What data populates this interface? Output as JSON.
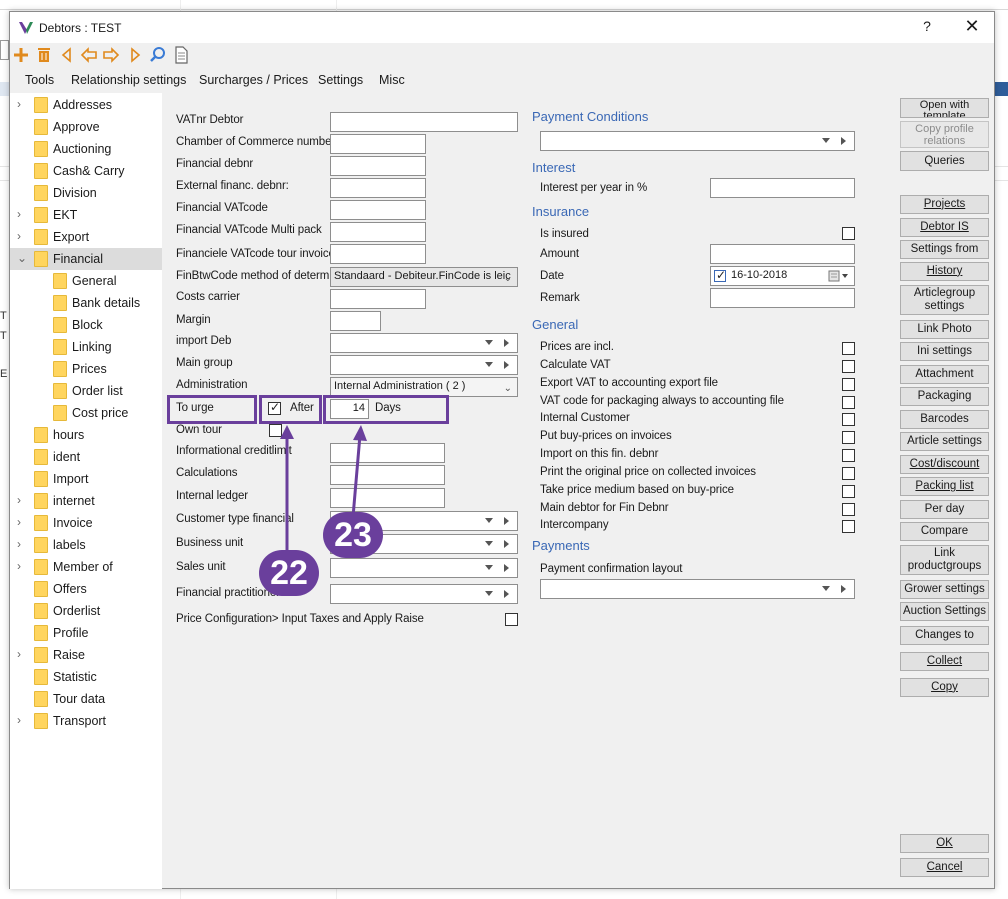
{
  "dialog": {
    "title": "Debtors : TEST",
    "help_label": "?",
    "close_label": "✕"
  },
  "menu": [
    "Tools",
    "Relationship settings",
    "Surcharges / Prices",
    "Settings",
    "Misc"
  ],
  "tree": [
    {
      "label": "Addresses",
      "expand": "›"
    },
    {
      "label": "Approve",
      "expand": ""
    },
    {
      "label": "Auctioning",
      "expand": ""
    },
    {
      "label": "Cash& Carry",
      "expand": ""
    },
    {
      "label": "Division",
      "expand": ""
    },
    {
      "label": "EKT",
      "expand": "›"
    },
    {
      "label": "Export",
      "expand": "›"
    },
    {
      "label": "Financial",
      "expand": "⌄"
    },
    {
      "label": "General",
      "expand": ""
    },
    {
      "label": "Bank details",
      "expand": ""
    },
    {
      "label": "Block",
      "expand": ""
    },
    {
      "label": "Linking",
      "expand": ""
    },
    {
      "label": "Prices",
      "expand": ""
    },
    {
      "label": "Order list",
      "expand": ""
    },
    {
      "label": "Cost price",
      "expand": ""
    },
    {
      "label": "hours",
      "expand": ""
    },
    {
      "label": "ident",
      "expand": ""
    },
    {
      "label": "Import",
      "expand": ""
    },
    {
      "label": "internet",
      "expand": "›"
    },
    {
      "label": "Invoice",
      "expand": "›"
    },
    {
      "label": "labels",
      "expand": "›"
    },
    {
      "label": "Member of",
      "expand": "›"
    },
    {
      "label": "Offers",
      "expand": ""
    },
    {
      "label": "Orderlist",
      "expand": ""
    },
    {
      "label": "Profile",
      "expand": ""
    },
    {
      "label": "Raise",
      "expand": "›"
    },
    {
      "label": "Statistic",
      "expand": ""
    },
    {
      "label": "Tour data",
      "expand": ""
    },
    {
      "label": "Transport",
      "expand": "›"
    }
  ],
  "form": {
    "vatnr_debtor": {
      "label": "VATnr Debtor",
      "value": ""
    },
    "chamber": {
      "label": "Chamber of Commerce number",
      "value": ""
    },
    "fin_debnr": {
      "label": "Financial debnr",
      "value": ""
    },
    "ext_debnr": {
      "label": "External financ. debnr:",
      "value": ""
    },
    "fin_vatcode": {
      "label": "Financial VATcode",
      "value": ""
    },
    "fin_vatcode_multi": {
      "label": "Financial VATcode Multi pack",
      "value": ""
    },
    "fin_vatcode_tour": {
      "label": "Financiele VATcode tour invoice",
      "value": ""
    },
    "finbtw_method": {
      "label": "FinBtwCode method of determina",
      "value": "Standaard - Debiteur.FinCode is leic"
    },
    "costs_carrier": {
      "label": "Costs carrier",
      "value": ""
    },
    "margin": {
      "label": "Margin",
      "value": ""
    },
    "import_deb": {
      "label": "import Deb",
      "value": ""
    },
    "main_group": {
      "label": "Main group",
      "value": ""
    },
    "administration": {
      "label": "Administration",
      "value": "Internal Administration  ( 2 )"
    },
    "to_urge": {
      "label": "To urge",
      "after_label": "After",
      "days_value": "14",
      "days_label": "Days"
    },
    "own_tour": {
      "label": "Own tour"
    },
    "info_creditlimit": {
      "label": "Informational creditlimit",
      "value": ""
    },
    "calculations": {
      "label": "Calculations",
      "value": ""
    },
    "internal_ledger": {
      "label": "Internal ledger",
      "value": ""
    },
    "customer_type_fin": {
      "label": "Customer type financial",
      "value": ""
    },
    "business_unit": {
      "label": "Business unit",
      "value": ""
    },
    "sales_unit": {
      "label": "Sales unit",
      "value": ""
    },
    "fin_practitioner": {
      "label": "Financial practitioner",
      "value": ""
    },
    "price_config": {
      "label": "Price Configuration> Input Taxes and Apply Raise"
    }
  },
  "right": {
    "payment_conditions": {
      "title": "Payment Conditions",
      "value": ""
    },
    "interest": {
      "title": "Interest",
      "per_year_label": "Interest per year in %",
      "value": ""
    },
    "insurance": {
      "title": "Insurance",
      "is_insured_label": "Is insured",
      "amount_label": "Amount",
      "amount_value": "",
      "date_label": "Date",
      "date_value": "16-10-2018",
      "remark_label": "Remark",
      "remark_value": ""
    },
    "general": {
      "title": "General",
      "items": [
        "Prices are incl.",
        "Calculate VAT",
        "Export VAT to accounting export file",
        "VAT code for packaging always to accounting file",
        "Internal Customer",
        "Put buy-prices on invoices",
        "Import on this fin. debnr",
        "Print the original price on collected invoices",
        "Take price medium based on buy-price",
        "Main debtor for Fin Debnr",
        "Intercompany"
      ]
    },
    "payments": {
      "title": "Payments",
      "layout_label": "Payment confirmation layout",
      "value": ""
    }
  },
  "buttons": {
    "open_template": "Open with template",
    "copy_profile": "Copy profile relations",
    "queries": "Queries",
    "projects": "Projects",
    "debtor_is": "Debtor IS",
    "settings_from": "Settings from",
    "history": "History",
    "articlegroup": "Articlegroup settings",
    "link_photo": "Link Photo",
    "ini_settings": "Ini settings",
    "attachment": "Attachment",
    "packaging": "Packaging",
    "barcodes": "Barcodes",
    "article_settings": "Article settings",
    "cost_discount": "Cost/discount",
    "packing_list": "Packing list",
    "per_day": "Per day",
    "compare": "Compare",
    "link_productgroups": "Link productgroups",
    "grower_settings": "Grower settings",
    "auction_settings": "Auction Settings",
    "changes_to": "Changes to",
    "collect": "Collect",
    "copy": "Copy",
    "ok": "OK",
    "cancel": "Cancel"
  },
  "annotations": {
    "badge_22": "22",
    "badge_23": "23"
  },
  "colors": {
    "accent_purple": "#6a3f9c",
    "section_blue": "#3a68b5",
    "folder_yellow": "#ffd55e"
  },
  "background": {
    "edge_chars": [
      "T",
      "T",
      "E"
    ]
  }
}
